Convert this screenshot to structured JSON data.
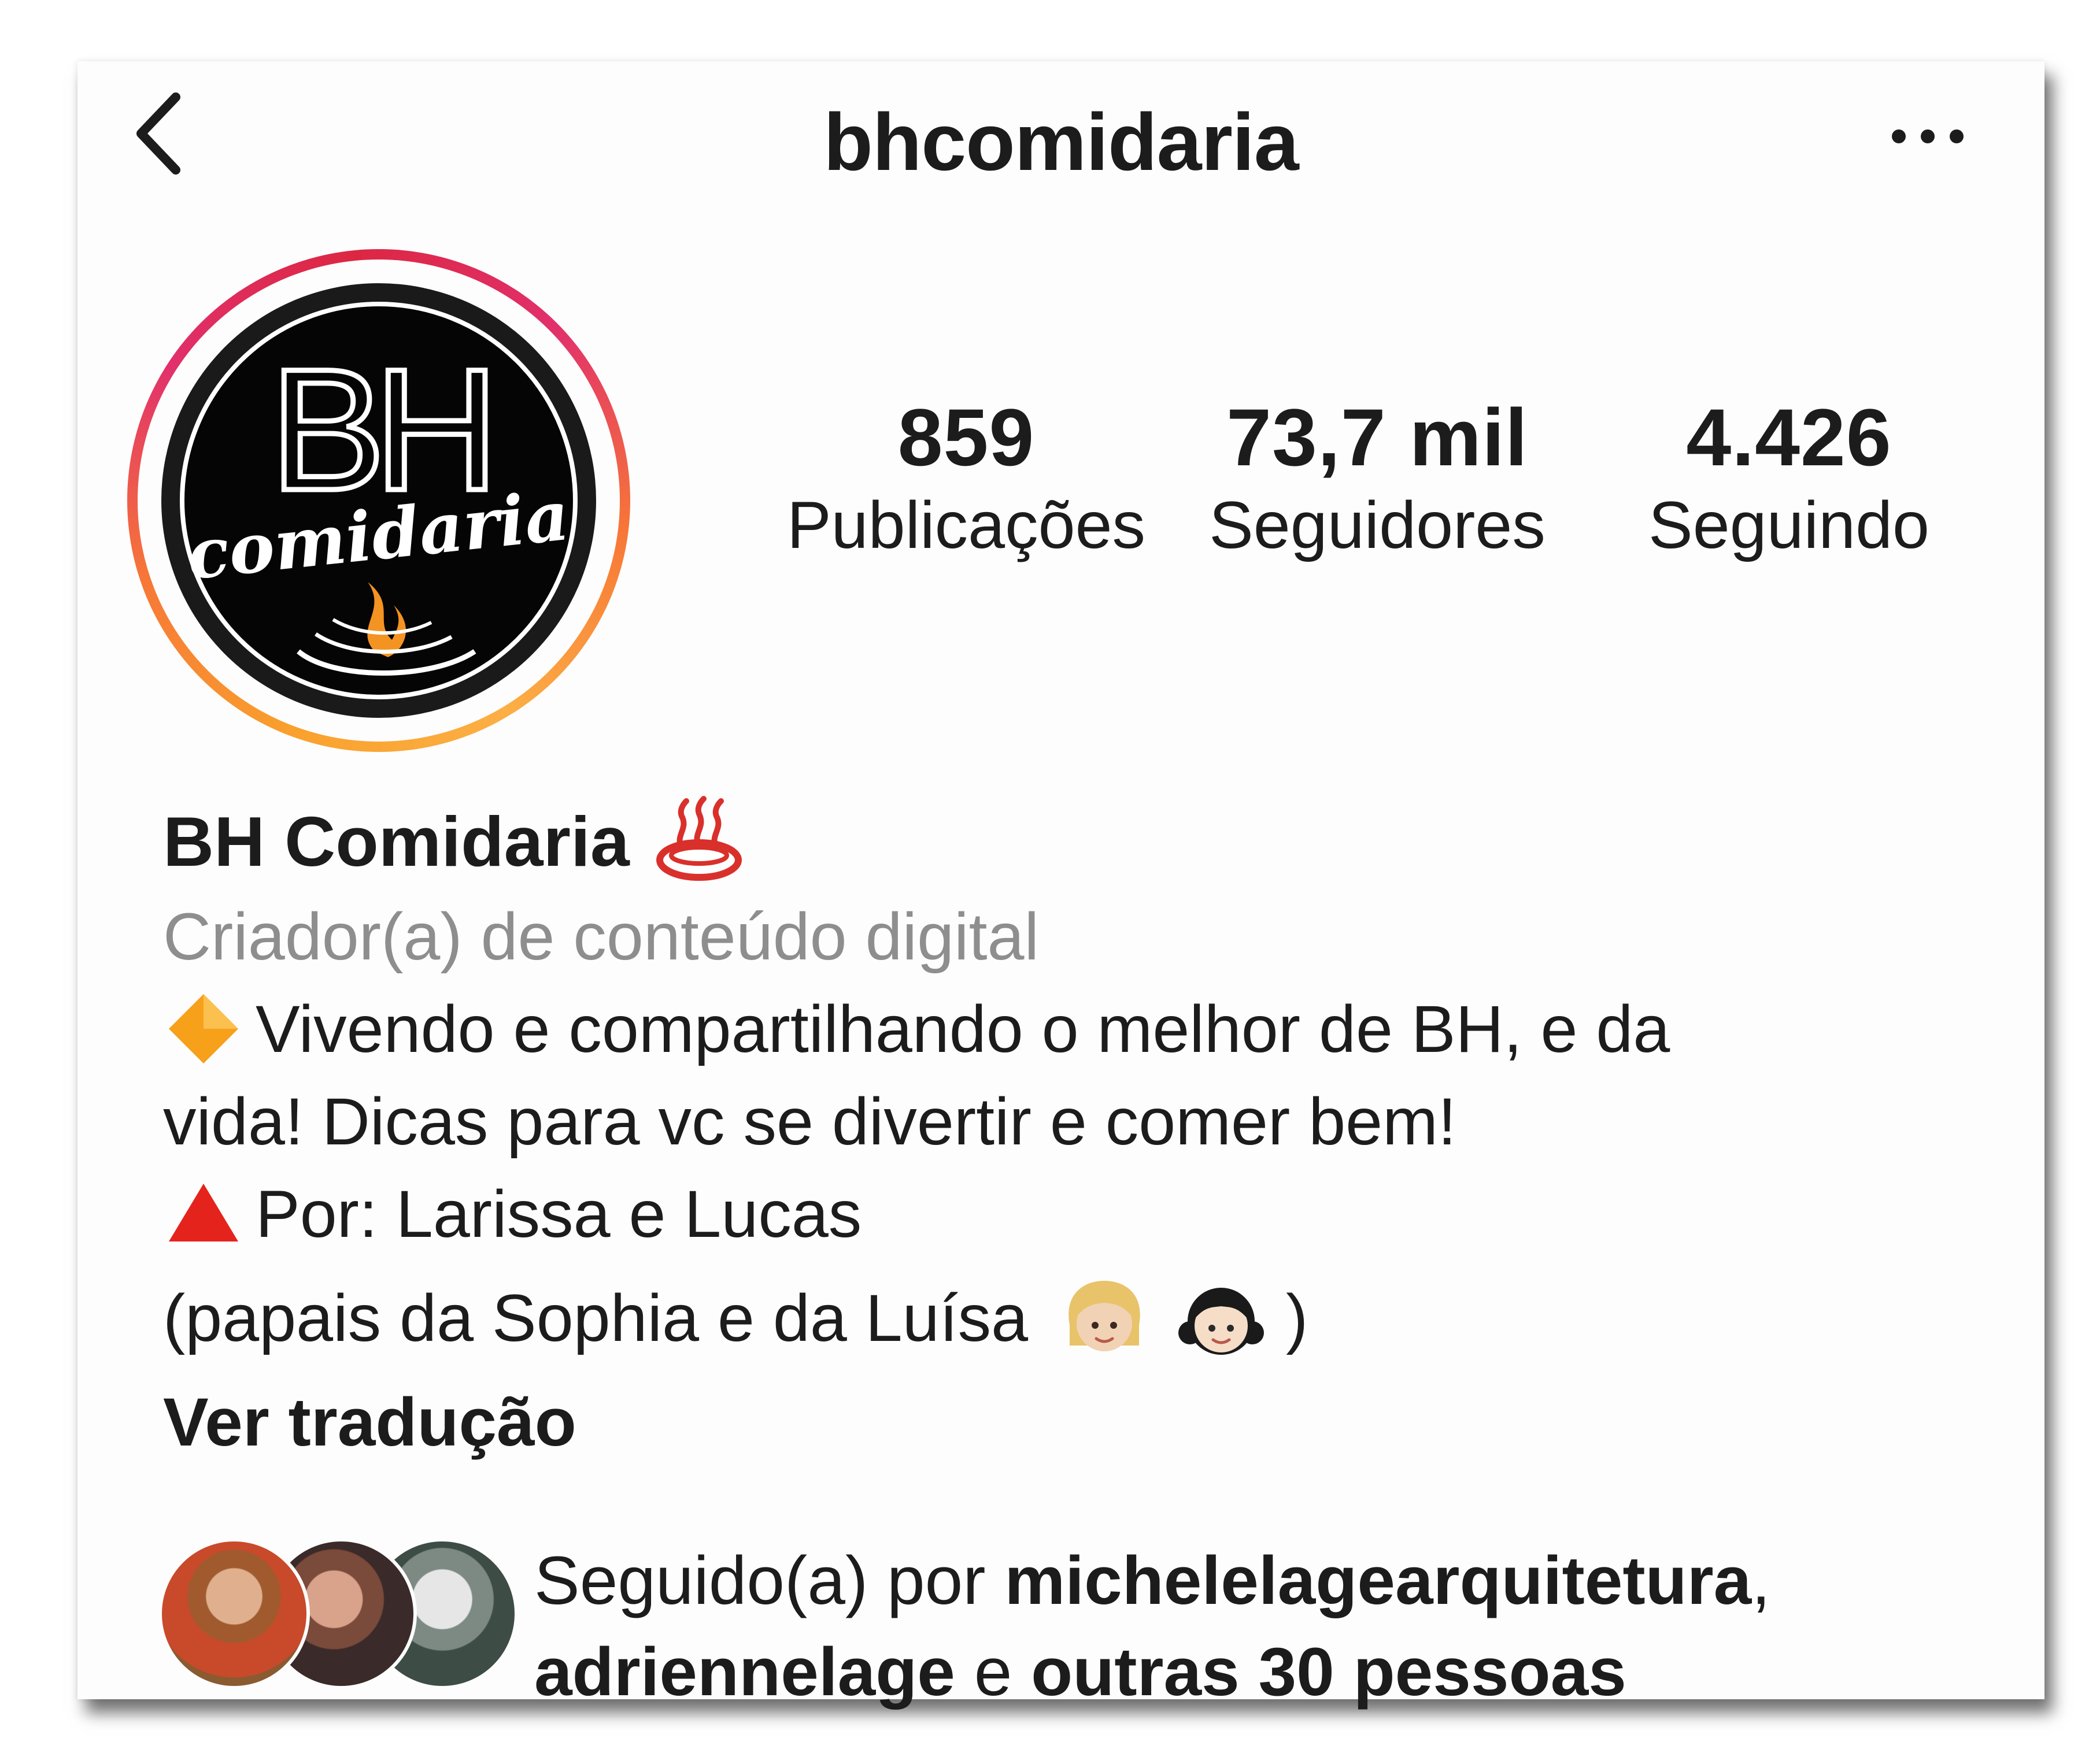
{
  "header": {
    "username": "bhcomidaria",
    "back_icon": "chevron-left-icon",
    "more_icon": "more-horizontal-icon"
  },
  "profile": {
    "avatar_logo_text_main": "BH",
    "avatar_logo_text_script": "comidaria",
    "stats": [
      {
        "value": "859",
        "label": "Publicações"
      },
      {
        "value": "73,7 mil",
        "label": "Seguidores"
      },
      {
        "value": "4.426",
        "label": "Seguindo"
      }
    ],
    "display_name": "BH Comidaria",
    "name_emoji": "hot-springs-icon",
    "category": "Criador(a) de conteúdo digital",
    "bio": {
      "line1": "Vivendo e compartilhando o melhor de BH, e da",
      "line2": "vida! Dicas para vc se divertir e comer bem!",
      "line3": "Por: Larissa e Lucas",
      "line4_prefix": "(papais da Sophia e da Luísa",
      "line4_suffix": ")",
      "bullet1_icon": "orange-diamond-icon",
      "bullet2_icon": "red-triangle-icon"
    },
    "translate_label": "Ver tradução"
  },
  "followed_by": {
    "prefix": "Seguido(a) por ",
    "user1": "michelelagearquitetura",
    "comma": ",",
    "user2": "adriennelage",
    "connector": " e ",
    "others": "outras 30 pessoas"
  },
  "colors": {
    "text": "#1c1c1c",
    "secondary_text": "#8e8e8e",
    "story_ring_start": "#f9a12d",
    "story_ring_end": "#e1306c"
  }
}
